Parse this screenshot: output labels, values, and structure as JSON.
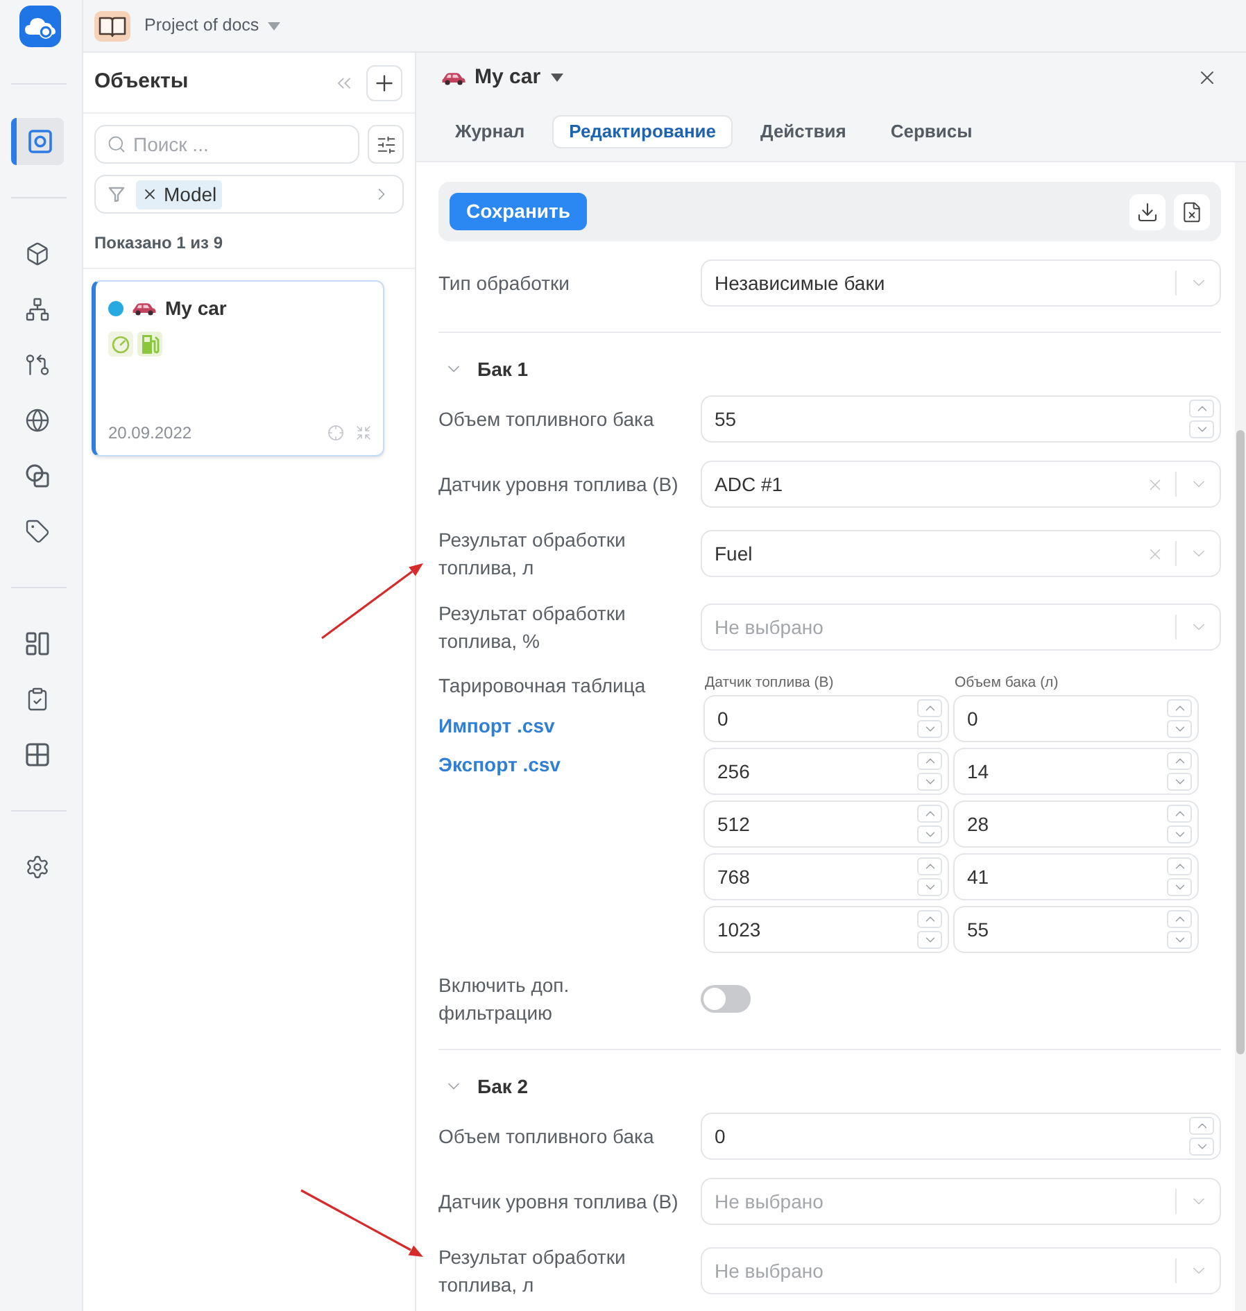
{
  "rail": {
    "groups": [
      {
        "items": [
          {
            "kind": "objects",
            "selected": true
          }
        ]
      },
      {
        "items": [
          {
            "kind": "cube",
            "selected": false
          },
          {
            "kind": "hierarchy",
            "selected": false
          },
          {
            "kind": "merge",
            "selected": false
          },
          {
            "kind": "globe",
            "selected": false
          },
          {
            "kind": "shapes",
            "selected": false
          },
          {
            "kind": "tag",
            "selected": false
          }
        ]
      },
      {
        "items": [
          {
            "kind": "panels",
            "selected": false
          },
          {
            "kind": "checklist",
            "selected": false
          },
          {
            "kind": "grid",
            "selected": false
          }
        ]
      },
      {
        "items": [
          {
            "kind": "settings",
            "selected": false
          }
        ]
      }
    ]
  },
  "project": {
    "name": "Project of docs"
  },
  "objects_panel": {
    "title": "Объекты",
    "search": {
      "placeholder": "Поиск ..."
    },
    "filter": {
      "chips": [
        {
          "label": "Model"
        }
      ]
    },
    "count": "Показано 1 из 9",
    "cards": [
      {
        "name": "My car",
        "color": "#27aae1",
        "badges": [
          {
            "kind": "gauge"
          },
          {
            "kind": "fuel"
          }
        ],
        "date": "20.09.2022",
        "selected": true
      }
    ]
  },
  "detail": {
    "title": "My car",
    "tabs": [
      {
        "label": "Журнал",
        "selected": false
      },
      {
        "label": "Редактирование",
        "selected": true
      },
      {
        "label": "Действия",
        "selected": false
      },
      {
        "label": "Сервисы",
        "selected": false
      }
    ],
    "save_button": "Сохранить",
    "processing": {
      "label": "Тип обработки",
      "value": "Независимые баки"
    },
    "tanks": [
      {
        "title": "Бак 1",
        "expanded": true,
        "fields": [
          {
            "kind": "number",
            "label": "Объем топливного бака",
            "value": "55"
          },
          {
            "kind": "select",
            "label": "Датчик уровня топлива (В)",
            "value": "ADC #1",
            "clearable": true
          },
          {
            "kind": "select",
            "label": "Результат обработки топлива, л",
            "value": "Fuel",
            "clearable": true
          },
          {
            "kind": "select",
            "label": "Результат обработки топлива, %",
            "placeholder": "Не выбрано"
          },
          {
            "kind": "calibration",
            "label": "Тарировочная таблица",
            "links": [
              "Импорт .csv",
              "Экспорт .csv"
            ],
            "columns": [
              "Датчик топлива (В)",
              "Объем бака (л)"
            ],
            "rows": [
              [
                "0",
                "0"
              ],
              [
                "256",
                "14"
              ],
              [
                "512",
                "28"
              ],
              [
                "768",
                "41"
              ],
              [
                "1023",
                "55"
              ]
            ]
          },
          {
            "kind": "switch",
            "label": "Включить доп. фильтрацию",
            "on": false
          }
        ]
      },
      {
        "title": "Бак 2",
        "expanded": true,
        "fields": [
          {
            "kind": "number",
            "label": "Объем топливного бака",
            "value": "0"
          },
          {
            "kind": "select",
            "label": "Датчик уровня топлива (В)",
            "placeholder": "Не выбрано"
          },
          {
            "kind": "select",
            "label": "Результат обработки топлива, л",
            "placeholder": "Не выбрано"
          }
        ]
      }
    ]
  }
}
